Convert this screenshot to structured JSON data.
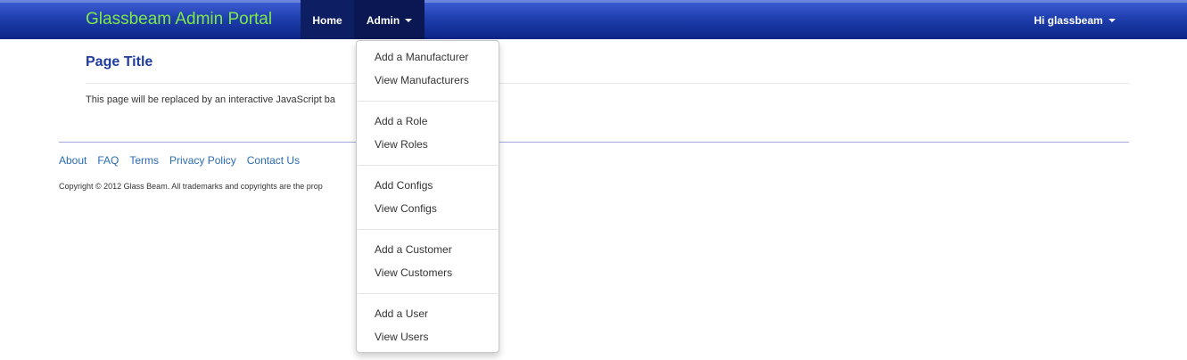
{
  "navbar": {
    "brand": "Glassbeam Admin Portal",
    "home_label": "Home",
    "admin_label": "Admin",
    "user_label": "Hi glassbeam"
  },
  "main": {
    "page_title": "Page Title",
    "body_text": "This page will be replaced by an interactive JavaScript ba"
  },
  "footer": {
    "links": [
      "About",
      "FAQ",
      "Terms",
      "Privacy Policy",
      "Contact Us"
    ],
    "copyright": "Copyright © 2012 Glass Beam. All trademarks and copyrights are the prop"
  },
  "admin_menu": {
    "items": [
      "Add a Manufacturer",
      "View Manufacturers",
      "Add a Role",
      "View Roles",
      "Add Configs",
      "View Configs",
      "Add a Customer",
      "View Customers",
      "Add a User",
      "View Users"
    ]
  },
  "colors": {
    "navbar": "#2040b0",
    "brand": "#7ee84b",
    "title": "#1f3c9e",
    "link": "#2a6bb5"
  }
}
